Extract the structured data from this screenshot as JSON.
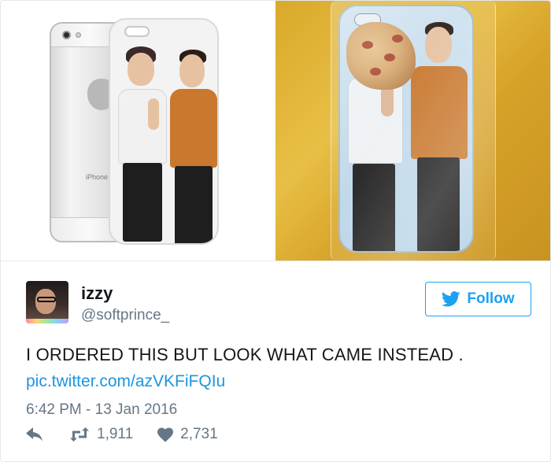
{
  "media": {
    "left_photo": {
      "phone_text": "iPhone"
    }
  },
  "user": {
    "name": "izzy",
    "handle": "@softprince_"
  },
  "follow": {
    "label": "Follow"
  },
  "tweet": {
    "text": "I ORDERED THIS BUT LOOK WHAT CAME INSTEAD .",
    "link": "pic.twitter.com/azVKFiFQIu",
    "timestamp": "6:42 PM - 13 Jan 2016"
  },
  "actions": {
    "retweets": "1,911",
    "likes": "2,731"
  },
  "colors": {
    "twitter_blue": "#1da1f2",
    "link_blue": "#1b95e0",
    "meta_gray": "#657786",
    "text_dark": "#14171a"
  },
  "icons": [
    "twitter-bird-icon",
    "reply-icon",
    "retweet-icon",
    "heart-icon"
  ]
}
